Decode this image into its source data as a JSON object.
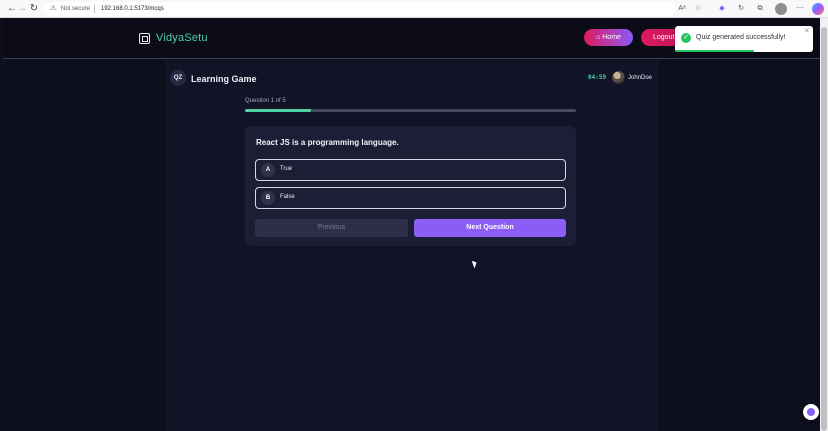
{
  "browser": {
    "security_label": "Not secure",
    "url": "192.168.0.1:5173/mcqs",
    "warn_icon": "warning-triangle-icon"
  },
  "header": {
    "app_name": "VidyaSetu",
    "home_label": "Home",
    "logout_label": "Logout"
  },
  "toast": {
    "message": "Quiz generated successfully!",
    "progress_fraction": 0.57,
    "color": "#22c55e"
  },
  "game": {
    "badge": "QZ",
    "title": "Learning Game",
    "timer": "04:59",
    "username": "JohnDoe",
    "progress_label": "Question 1 of 5",
    "progress_fraction": 0.2,
    "accent_color": "#4fd1a5"
  },
  "question": {
    "text": "React JS is a programming language.",
    "options": [
      {
        "letter": "A",
        "text": "True"
      },
      {
        "letter": "B",
        "text": "False"
      }
    ]
  },
  "actions": {
    "previous_label": "Previous",
    "next_label": "Next Question",
    "next_color": "#8b5cf6"
  }
}
